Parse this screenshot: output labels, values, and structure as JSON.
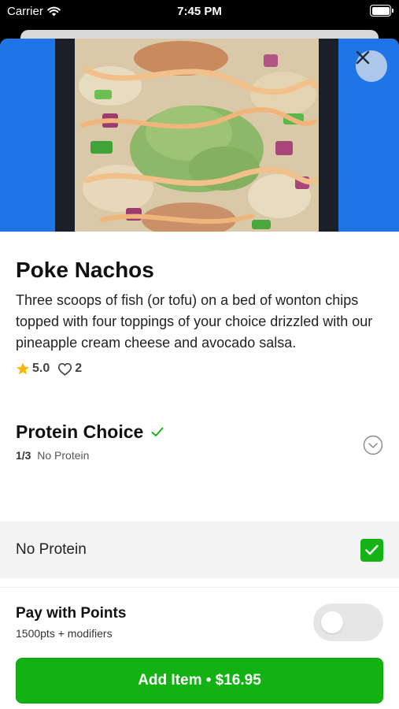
{
  "status_bar": {
    "carrier": "Carrier",
    "time": "7:45 PM"
  },
  "item": {
    "title": "Poke Nachos",
    "description": "Three scoops of fish (or tofu) on a bed of wonton chips topped with four toppings of your choice drizzled with our pineapple cream cheese and avocado salsa.",
    "rating": "5.0",
    "likes": "2"
  },
  "section": {
    "title": "Protein Choice",
    "count": "1/3",
    "selected": "No Protein"
  },
  "option": {
    "label": "No Protein",
    "checked": true
  },
  "points": {
    "title": "Pay with Points",
    "subtitle": "1500pts + modifiers",
    "enabled": false
  },
  "cta": {
    "label": "Add Item • $16.95"
  },
  "colors": {
    "accent": "#11b211",
    "hero_bg": "#1a6fe3",
    "star": "#f5b800"
  }
}
